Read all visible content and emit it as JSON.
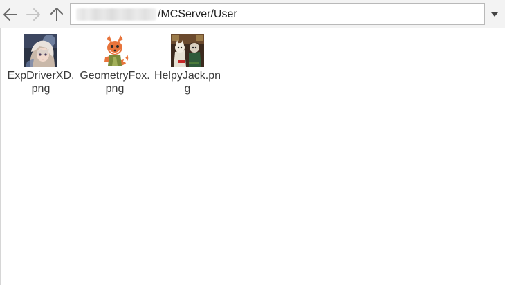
{
  "toolbar": {
    "back_icon": "arrow-left-icon",
    "forward_icon": "arrow-right-icon",
    "up_icon": "arrow-up-icon",
    "dropdown_icon": "caret-down-icon"
  },
  "address": {
    "path": "/MCServer/User"
  },
  "files": [
    {
      "name": "ExpDriverXD.png",
      "thumbnail": "anime-girl-portrait"
    },
    {
      "name": "GeometryFox.png",
      "thumbnail": "cartoon-fox"
    },
    {
      "name": "HelpyJack.png",
      "thumbnail": "two-cartoon-characters"
    }
  ],
  "colors": {
    "toolbar_bg": "#f3f3f3",
    "text": "#3a3a3a",
    "border": "#b9b9b9"
  }
}
